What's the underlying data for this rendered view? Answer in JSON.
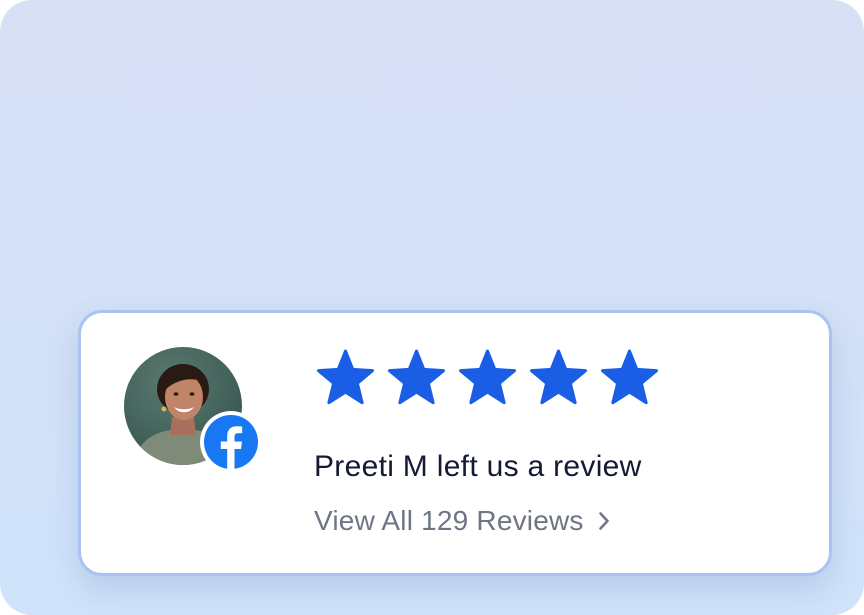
{
  "review": {
    "reviewer_line": "Preeti M left us a review",
    "view_all_link": "View All 129 Reviews",
    "rating": 5,
    "max_rating": 5,
    "platform_icon": "facebook-icon"
  },
  "colors": {
    "star": "#1b5ee6",
    "facebook": "#1877f2",
    "card_border": "#a9c3f2",
    "title_text": "#141a33",
    "link_text": "#6f7585"
  }
}
